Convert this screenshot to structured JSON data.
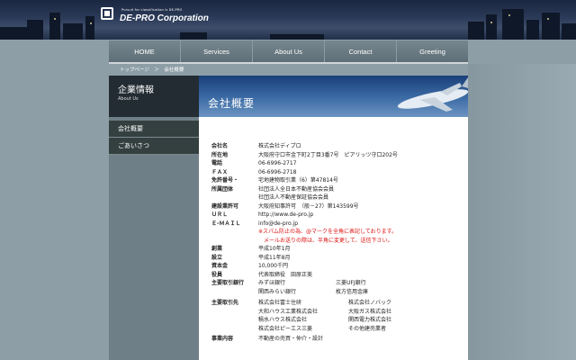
{
  "header": {
    "logo_sub": "Pursuit for classification is DE-PRO",
    "logo_name": "DE-PRO Corporation"
  },
  "nav": [
    "HOME",
    "Services",
    "About Us",
    "Contact",
    "Greeting"
  ],
  "breadcrumb": "トップページ　＞　会社概要",
  "sidebar": {
    "title": "企業情報",
    "subtitle": "About Us",
    "items": [
      "会社概要",
      "ごあいさつ"
    ]
  },
  "page_title": "会社概要",
  "rows": [
    {
      "label": "会社名",
      "lines": [
        "株式会社ディプロ"
      ]
    },
    {
      "label": "所在地",
      "lines": [
        "大阪府守口市金下町2丁目3番7号　ピアリッツ守口202号"
      ]
    },
    {
      "label": "電話",
      "lines": [
        "06-6996-2717"
      ]
    },
    {
      "label": "ＦＡＸ",
      "lines": [
        "06-6996-2718"
      ]
    },
    {
      "label": "免許番号・",
      "lines": [
        "宅地建物取引業（6）第47814号"
      ]
    },
    {
      "label": "所属団体",
      "lines": [
        "社団法人全日本不動産協会会員",
        "社団法人不動産保証協会会員"
      ]
    },
    {
      "label": "建設業許可",
      "lines": [
        "大阪府知事許可　（般－27）第143599号"
      ]
    },
    {
      "label": "ＵＲＬ",
      "lines": [
        "http://www.de-pro.jp"
      ]
    },
    {
      "label": "Ｅ-ＭＡＩＬ",
      "lines": [
        "info@de-pro.jp"
      ],
      "notes": [
        "※スパム防止の為、@マークを全角に表記しております。",
        "　メールお送りの際は、半角に変更して、送信下さい。"
      ]
    },
    {
      "label": "創業",
      "lines": [
        "平成10年1月"
      ]
    },
    {
      "label": "設立",
      "lines": [
        "平成11年8月"
      ]
    },
    {
      "label": "資本金",
      "lines": [
        "10,000千円"
      ]
    },
    {
      "label": "役員",
      "lines": [
        "代表取締役　田原正美"
      ]
    }
  ],
  "banks": {
    "label": "主要取引銀行",
    "rows": [
      [
        "みずほ銀行",
        "三菱UFJ銀行"
      ],
      [
        "関西みらい銀行",
        "枚方信用金庫"
      ]
    ]
  },
  "clients": {
    "label": "主要取引先",
    "rows": [
      [
        "株式会社富士住研",
        "株式会社ノバック"
      ],
      [
        "大和ハウス工業株式会社",
        "大阪ガス株式会社"
      ],
      [
        "積水ハウス株式会社",
        "関西電力株式会社"
      ],
      [
        "株式会社ピーエス三菱",
        "その他建売業者"
      ]
    ]
  },
  "last": {
    "label": "事業内容",
    "text": "不動産の売買・仲介・設計"
  }
}
